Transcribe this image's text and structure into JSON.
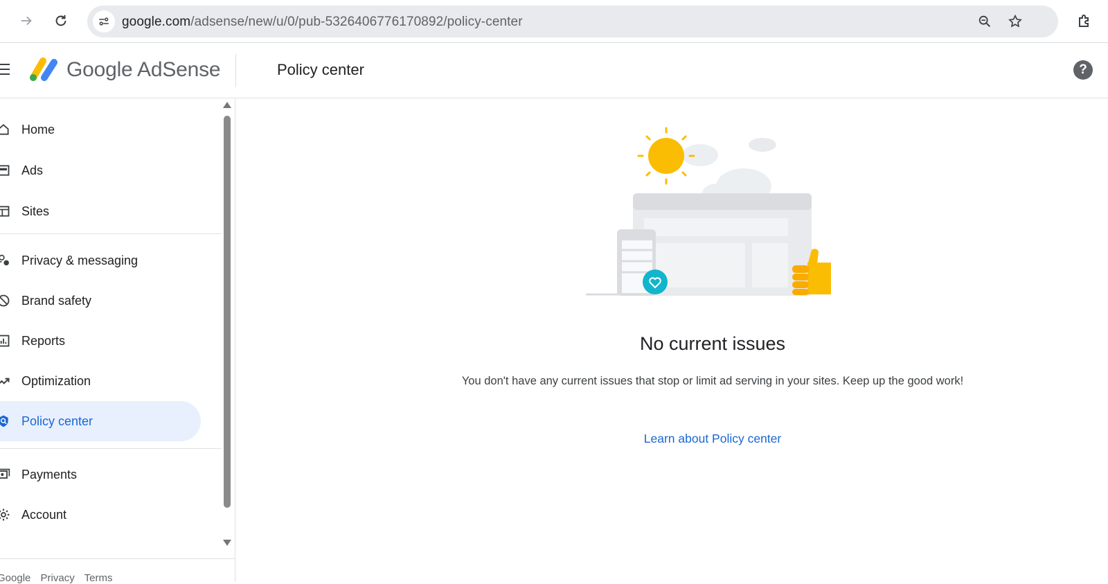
{
  "browser": {
    "url_host": "google.com",
    "url_path": "/adsense/new/u/0/pub-5326406776170892/policy-center"
  },
  "header": {
    "brand_google": "Google",
    "brand_product": "AdSense",
    "page_title": "Policy center",
    "help": "?"
  },
  "sidebar": {
    "items": [
      {
        "label": "Home",
        "icon": "home-icon"
      },
      {
        "label": "Ads",
        "icon": "ads-icon"
      },
      {
        "label": "Sites",
        "icon": "sites-icon"
      },
      {
        "label": "Privacy & messaging",
        "icon": "privacy-icon"
      },
      {
        "label": "Brand safety",
        "icon": "block-icon"
      },
      {
        "label": "Reports",
        "icon": "reports-icon"
      },
      {
        "label": "Optimization",
        "icon": "trending-up-icon"
      },
      {
        "label": "Policy center",
        "icon": "policy-icon",
        "active": true
      },
      {
        "label": "Payments",
        "icon": "payments-icon"
      },
      {
        "label": "Account",
        "icon": "gear-icon"
      }
    ],
    "footer": [
      "Google",
      "Privacy",
      "Terms"
    ]
  },
  "main": {
    "status_title": "No current issues",
    "status_description": "You don't have any current issues that stop or limit ad serving in your sites. Keep up the good work!",
    "learn_link": "Learn about Policy center"
  },
  "colors": {
    "accent": "#1967d2",
    "active_bg": "#e8f0fe",
    "sun": "#fbbc04",
    "teal": "#12b5cb"
  }
}
